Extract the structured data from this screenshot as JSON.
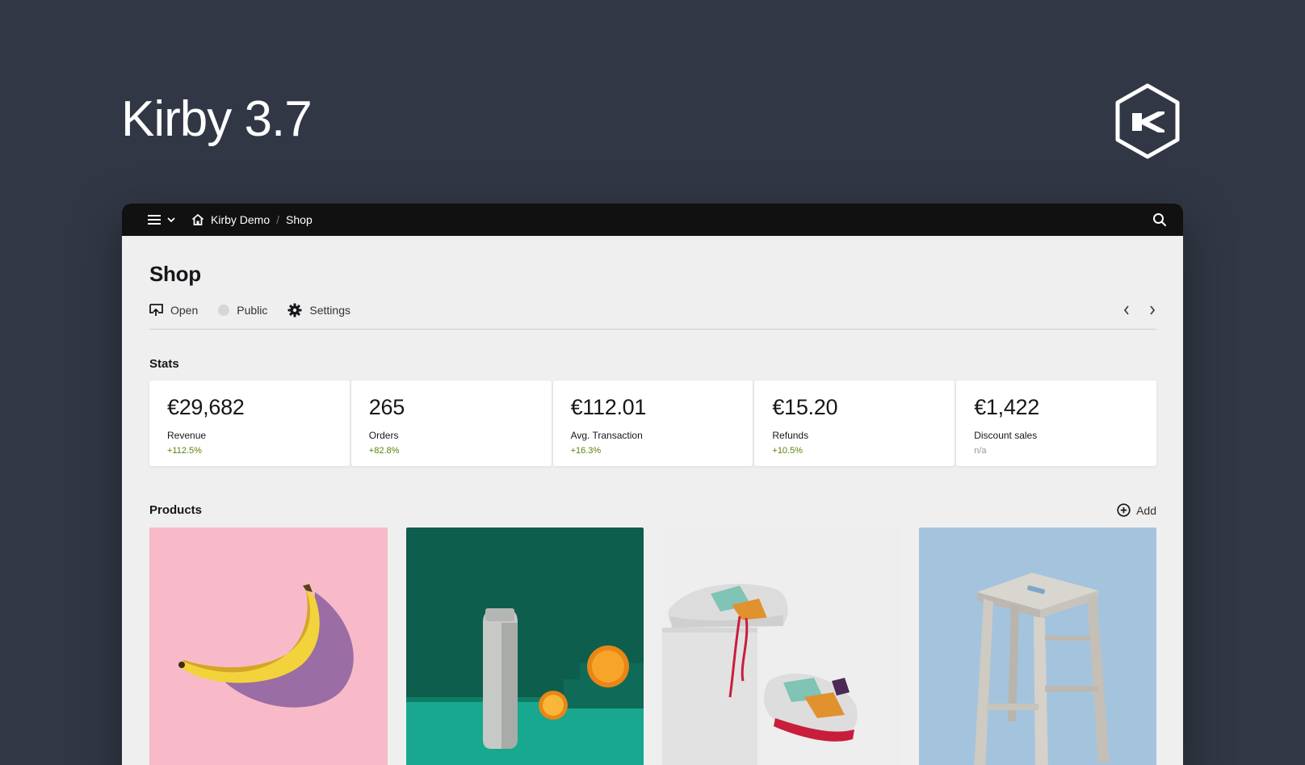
{
  "hero": {
    "title": "Kirby 3.7"
  },
  "topbar": {
    "breadcrumbs": [
      {
        "label": "Kirby Demo"
      },
      {
        "label": "Shop"
      }
    ],
    "separator": "/"
  },
  "page": {
    "title": "Shop",
    "actions": {
      "open_label": "Open",
      "status_label": "Public",
      "settings_label": "Settings"
    }
  },
  "stats": {
    "heading": "Stats",
    "items": [
      {
        "value": "€29,682",
        "label": "Revenue",
        "change": "+112.5%"
      },
      {
        "value": "265",
        "label": "Orders",
        "change": "+82.8%"
      },
      {
        "value": "€112.01",
        "label": "Avg. Transaction",
        "change": "+16.3%"
      },
      {
        "value": "€15.20",
        "label": "Refunds",
        "change": "+10.5%"
      },
      {
        "value": "€1,422",
        "label": "Discount sales",
        "change": "n/a"
      }
    ]
  },
  "products": {
    "heading": "Products",
    "add_label": "Add",
    "items": [
      {
        "image": "banana",
        "bg_color": "#f8bac8"
      },
      {
        "image": "water-bottle",
        "bg_color": "#0d5e4d"
      },
      {
        "image": "sneakers",
        "bg_color": "#eeeeee"
      },
      {
        "image": "wooden-stool",
        "bg_color": "#a4c4dd"
      }
    ]
  },
  "colors": {
    "background": "#313744",
    "topbar": "#111111",
    "panel": "#efefef",
    "positive": "#5d800d"
  }
}
